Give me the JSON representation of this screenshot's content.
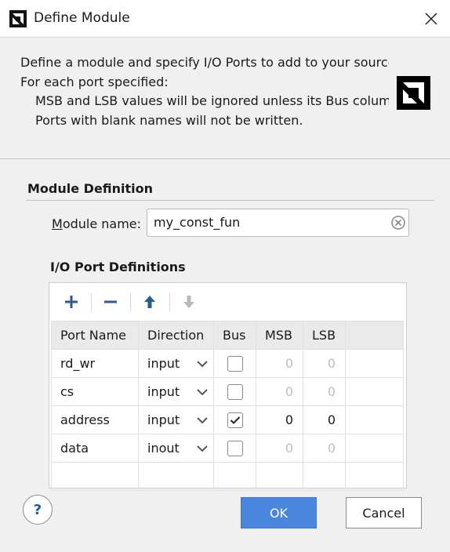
{
  "window": {
    "title": "Define Module"
  },
  "intro": {
    "line1": "Define a module and specify I/O Ports to add to your source",
    "line2": "For each port specified:",
    "line3": "MSB and LSB values will be ignored unless its Bus column",
    "line4": "Ports with blank names will not be written."
  },
  "module_definition": {
    "section_title": "Module Definition",
    "name_label_first": "M",
    "name_label_rest": "odule name:",
    "name_value": "my_const_fun"
  },
  "io_ports": {
    "section_title": "I/O Port Definitions",
    "toolbar": {
      "add_icon": "plus-icon",
      "remove_icon": "minus-icon",
      "move_up_icon": "arrow-up-icon",
      "move_down_icon": "arrow-down-icon"
    },
    "columns": [
      "Port Name",
      "Direction",
      "Bus",
      "MSB",
      "LSB"
    ],
    "rows": [
      {
        "name": "rd_wr",
        "direction": "input",
        "bus": false,
        "msb": "0",
        "lsb": "0"
      },
      {
        "name": "cs",
        "direction": "input",
        "bus": false,
        "msb": "0",
        "lsb": "0"
      },
      {
        "name": "address",
        "direction": "input",
        "bus": true,
        "msb": "0",
        "lsb": "0"
      },
      {
        "name": "data",
        "direction": "inout",
        "bus": false,
        "msb": "0",
        "lsb": "0"
      }
    ]
  },
  "footer": {
    "help_label": "?",
    "ok_label": "OK",
    "cancel_label": "Cancel"
  },
  "colors": {
    "accent": "#4a86dd",
    "toolbar_icon": "#2e5a8c",
    "disabled_icon": "#b9b9b9"
  }
}
